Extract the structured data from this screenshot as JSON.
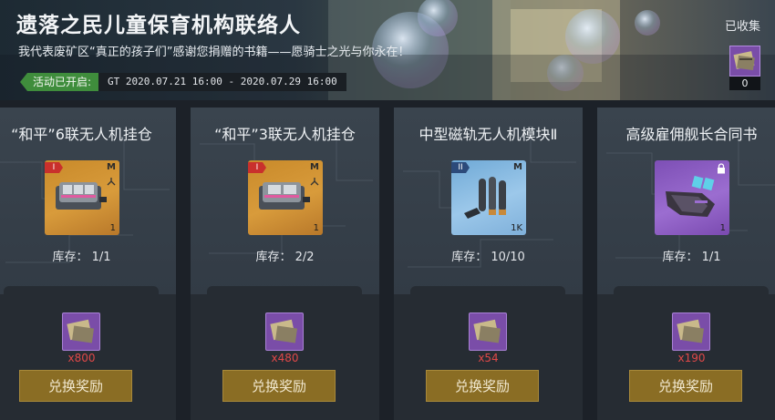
{
  "header": {
    "title": "遗落之民儿童保育机构联络人",
    "subtitle": "我代表废矿区“真正的孩子们”感谢您捐赠的书籍——愿骑士之光与你永在！",
    "event_label": "活动已开启:",
    "event_time": "GT 2020.07.21 16:00 - 2020.07.29 16:00",
    "collected_label": "已收集",
    "collected_count": "0",
    "collected_icon": "book-token-icon"
  },
  "colors": {
    "event_green": "#3f8d3c",
    "cost_red": "#e04848",
    "button_gold": "#8a6d24",
    "token_purple": "#7a4da8"
  },
  "cards": [
    {
      "name": "“和平”6联无人机挂仓",
      "rarity": "gold",
      "tier": "I",
      "size": "M",
      "quantity": "1",
      "stock": "库存： 1/1",
      "cost": "x800",
      "button": "兑换奖励",
      "icon": "drone-pod-icon"
    },
    {
      "name": "“和平”3联无人机挂仓",
      "rarity": "gold",
      "tier": "I",
      "size": "M",
      "quantity": "1",
      "stock": "库存： 2/2",
      "cost": "x480",
      "button": "兑换奖励",
      "icon": "drone-pod-icon"
    },
    {
      "name": "中型磁轨无人机模块Ⅱ",
      "rarity": "blue",
      "tier": "II",
      "size": "M",
      "quantity": "1K",
      "stock": "库存： 10/10",
      "cost": "x54",
      "button": "兑换奖励",
      "icon": "railgun-ammo-icon"
    },
    {
      "name": "高级雇佣舰长合同书",
      "rarity": "purple",
      "quantity": "1",
      "locked": true,
      "stock": "库存： 1/1",
      "cost": "x190",
      "button": "兑换奖励",
      "icon": "contract-device-icon"
    }
  ]
}
